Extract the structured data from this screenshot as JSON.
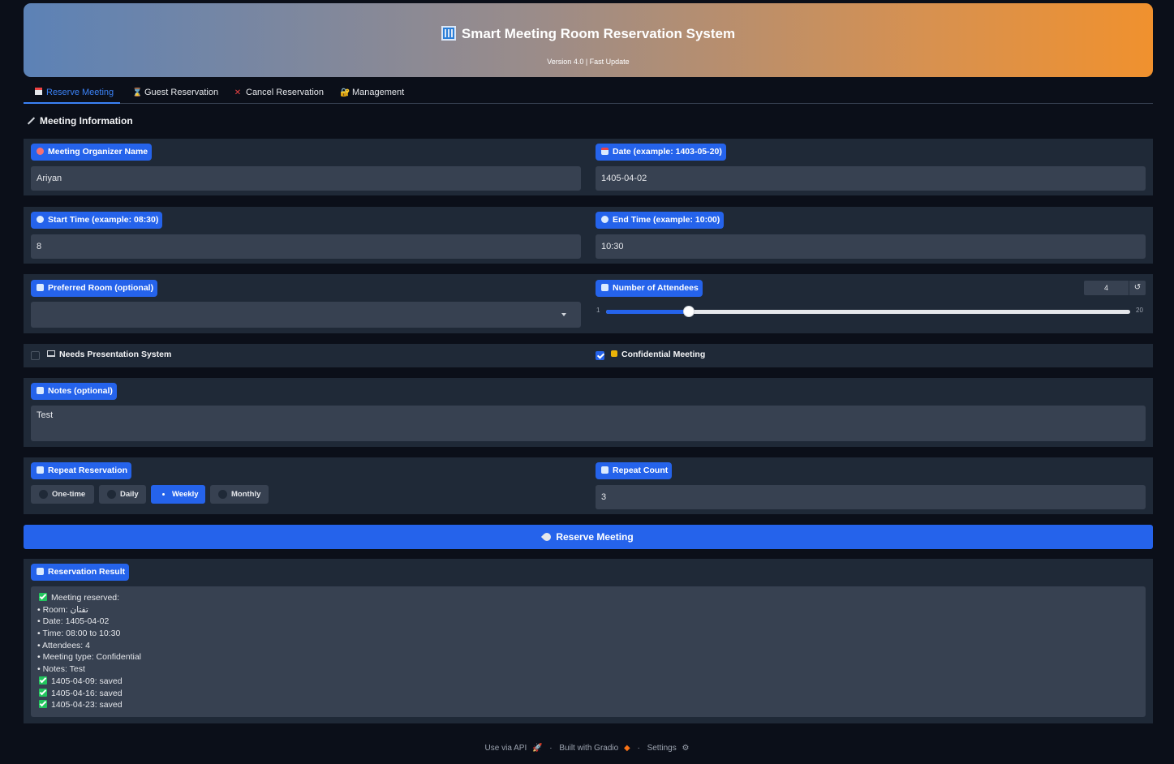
{
  "header": {
    "title": "Smart Meeting Room Reservation System",
    "subtitle": "Version 4.0 | Fast Update"
  },
  "tabs": [
    {
      "label": "Reserve Meeting",
      "icon": "calendar-icon",
      "active": true
    },
    {
      "label": "Guest Reservation",
      "icon": "hourglass-icon",
      "active": false
    },
    {
      "label": "Cancel Reservation",
      "icon": "cross-icon",
      "active": false
    },
    {
      "label": "Management",
      "icon": "lock-key-icon",
      "active": false
    }
  ],
  "section": {
    "title": "Meeting Information"
  },
  "form": {
    "organizer": {
      "label": "Meeting Organizer Name",
      "value": "Ariyan"
    },
    "date": {
      "label": "Date (example: 1403-05-20)",
      "value": "1405-04-02"
    },
    "start_time": {
      "label": "Start Time (example: 08:30)",
      "value": "8"
    },
    "end_time": {
      "label": "End Time (example: 10:00)",
      "value": "10:30"
    },
    "room": {
      "label": "Preferred Room (optional)",
      "value": ""
    },
    "attendees": {
      "label": "Number of Attendees",
      "value": "4",
      "min": "1",
      "max": "20",
      "reset_label": "↺"
    },
    "presentation": {
      "label": "Needs Presentation System",
      "checked": false
    },
    "confidential": {
      "label": "Confidential Meeting",
      "checked": true
    },
    "notes": {
      "label": "Notes (optional)",
      "value": "Test"
    },
    "repeat": {
      "label": "Repeat Reservation",
      "options": [
        "One-time",
        "Daily",
        "Weekly",
        "Monthly"
      ],
      "selected": "Weekly"
    },
    "repeat_count": {
      "label": "Repeat Count",
      "value": "3"
    }
  },
  "reserve_button": {
    "label": "Reserve Meeting"
  },
  "result": {
    "label": "Reservation Result",
    "lines": [
      "Meeting reserved:",
      "• Room: تفتان",
      "• Date: 1405-04-02",
      "• Time: 08:00 to 10:30",
      "• Attendees: 4",
      "• Meeting type: Confidential",
      "• Notes: Test",
      "1405-04-09: saved",
      "1405-04-16: saved",
      "1405-04-23: saved"
    ]
  },
  "footer": {
    "api": "Use via API",
    "built": "Built with Gradio",
    "settings": "Settings",
    "sep": "·"
  },
  "colors": {
    "accent": "#2563eb",
    "panel": "#1f2937",
    "input": "#374151",
    "background": "#0b0f19"
  }
}
